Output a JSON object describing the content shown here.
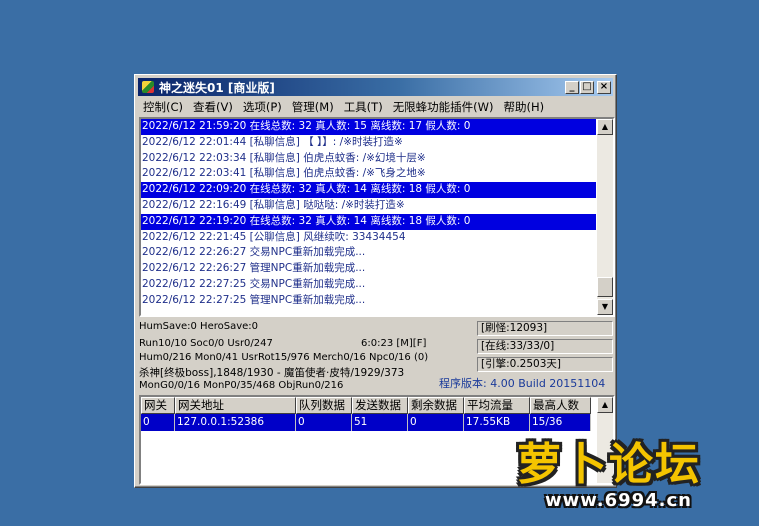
{
  "window": {
    "title": "神之迷失01 [商业版]"
  },
  "menu": [
    {
      "label": "控制(C)"
    },
    {
      "label": "查看(V)"
    },
    {
      "label": "选项(P)"
    },
    {
      "label": "管理(M)"
    },
    {
      "label": "工具(T)"
    },
    {
      "label": "无限蜂功能插件(W)"
    },
    {
      "label": "帮助(H)"
    }
  ],
  "log": [
    {
      "text": "2022/6/12 21:59:20 在线总数: 32 真人数: 15 离线数: 17 假人数: 0",
      "highlight": true
    },
    {
      "text": "2022/6/12 22:01:44 [私聊信息] 【 】】: /※时装打造※",
      "highlight": false
    },
    {
      "text": "2022/6/12 22:03:34 [私聊信息] 伯虎点蚊香: /※幻境十层※",
      "highlight": false
    },
    {
      "text": "2022/6/12 22:03:41 [私聊信息] 伯虎点蚊香: /※飞身之地※",
      "highlight": false
    },
    {
      "text": "2022/6/12 22:09:20 在线总数: 32 真人数: 14 离线数: 18 假人数: 0",
      "highlight": true
    },
    {
      "text": "2022/6/12 22:16:49 [私聊信息] 哒哒哒: /※时装打造※",
      "highlight": false
    },
    {
      "text": "2022/6/12 22:19:20 在线总数: 32 真人数: 14 离线数: 18 假人数: 0",
      "highlight": true
    },
    {
      "text": "2022/6/12 22:21:45 [公聊信息] 风继续吹: 33434454",
      "highlight": false
    },
    {
      "text": "2022/6/12 22:26:27 交易NPC重新加载完成...",
      "highlight": false
    },
    {
      "text": "2022/6/12 22:26:27 管理NPC重新加载完成...",
      "highlight": false
    },
    {
      "text": "2022/6/12 22:27:25 交易NPC重新加载完成...",
      "highlight": false
    },
    {
      "text": "2022/6/12 22:27:25 管理NPC重新加载完成...",
      "highlight": false
    }
  ],
  "status": {
    "line1": "HumSave:0 HeroSave:0",
    "line2": "Run10/10 Soc0/0 Usr0/247",
    "time": "6:0:23 [M][F]",
    "line3": "Hum0/216 Mon0/41 UsrRot15/976 Merch0/16 Npc0/16 (0)",
    "line4": "杀神[终极boss],1848/1930 - 魔笛使者·皮特/1929/373",
    "line5": "MonG0/0/16 MonP0/35/468 ObjRun0/216",
    "refresh": "[刷怪:12093]",
    "online": "[在线:33/33/0]",
    "engine": "[引擎:0.2503天]",
    "version": "程序版本: 4.00 Build 20151104"
  },
  "grid": {
    "headers": [
      "网关",
      "网关地址",
      "队列数据",
      "发送数据",
      "剩余数据",
      "平均流量",
      "最高人数"
    ],
    "rows": [
      [
        "0",
        "127.0.0.1:52386",
        "0",
        "51",
        "0",
        "17.55KB",
        "15/36"
      ]
    ]
  },
  "watermark": {
    "title": "萝卜论坛",
    "url": "www.6994.cn"
  }
}
